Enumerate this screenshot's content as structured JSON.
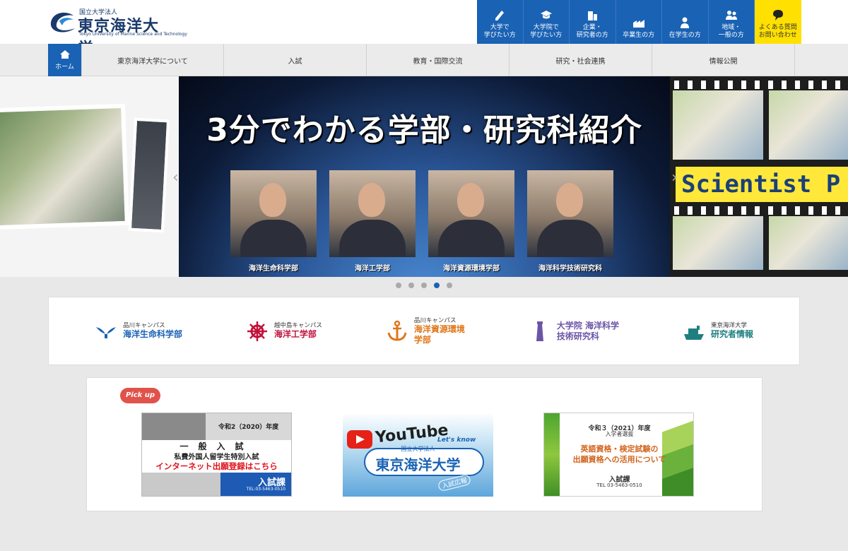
{
  "header": {
    "logo_sub": "国立大学法人",
    "logo_name": "東京海洋大学",
    "logo_eng": "Tokyo University of Marine Science and Technology",
    "audience": [
      {
        "line1": "大学で",
        "line2": "学びたい方",
        "icon": "pencil-icon"
      },
      {
        "line1": "大学院で",
        "line2": "学びたい方",
        "icon": "graduation-cap-icon"
      },
      {
        "line1": "企業・",
        "line2": "研究者の方",
        "icon": "building-icon"
      },
      {
        "line1": "",
        "line2": "卒業生の方",
        "icon": "factory-icon"
      },
      {
        "line1": "",
        "line2": "在学生の方",
        "icon": "person-icon"
      },
      {
        "line1": "地域・",
        "line2": "一般の方",
        "icon": "people-icon"
      }
    ],
    "faq": {
      "line1": "よくある質問",
      "line2": "お問い合わせ",
      "icon": "speech-bubble-icon"
    },
    "accent_color": "#1a62b4",
    "faq_color": "#ffe000"
  },
  "nav": {
    "home_label": "ホーム",
    "items": [
      "東京海洋大学について",
      "入試",
      "教育・国際交流",
      "研究・社会連携",
      "情報公開"
    ]
  },
  "slider": {
    "main_title": "3分でわかる学部・研究科紹介",
    "people": [
      {
        "caption": "海洋生命科学部"
      },
      {
        "caption": "海洋工学部"
      },
      {
        "caption": "海洋資源環境学部"
      },
      {
        "caption": "海洋科学技術研究科"
      }
    ],
    "right_text": "Scientist P",
    "dot_count": 5,
    "active_dot": 4
  },
  "faculties": [
    {
      "campus": "品川キャンパス",
      "name": "海洋生命科学部",
      "name2": "",
      "color": "#1a62b4",
      "icon": "whale-tail-icon"
    },
    {
      "campus": "越中島キャンパス",
      "name": "海洋工学部",
      "name2": "",
      "color": "#c2123c",
      "icon": "ship-wheel-icon"
    },
    {
      "campus": "品川キャンパス",
      "name": "海洋資源環境",
      "name2": "学部",
      "color": "#e0761b",
      "icon": "anchor-icon"
    },
    {
      "campus": "",
      "name": "大学院 海洋科学",
      "name2": "技術研究科",
      "color": "#6a55a8",
      "icon": "lighthouse-icon"
    },
    {
      "campus": "東京海洋大学",
      "name": "研究者情報",
      "name2": "",
      "color": "#1f7f7f",
      "icon": "research-ship-icon"
    }
  ],
  "pickup": {
    "badge": "Pick up",
    "banner1": {
      "era": "令和2（2020）年度",
      "line1": "一般入試",
      "line2": "私費外国人留学生特別入試",
      "line3": "インターネット出願登録はこちら",
      "dept": "入試課",
      "tel": "TEL:03-5463-0510"
    },
    "banner2": {
      "youtube": "YouTube",
      "lets": "Let's know",
      "uni_sub": "国立大学法人",
      "uni": "東京海洋大学",
      "pr": "入試広報"
    },
    "banner3": {
      "era": "令和３（2021）年度",
      "sub": "入学者選抜",
      "line1": "英語資格・検定試験の",
      "line2": "出願資格への活用について",
      "dept": "入試課",
      "tel": "TEL 03-5463-0510"
    }
  }
}
